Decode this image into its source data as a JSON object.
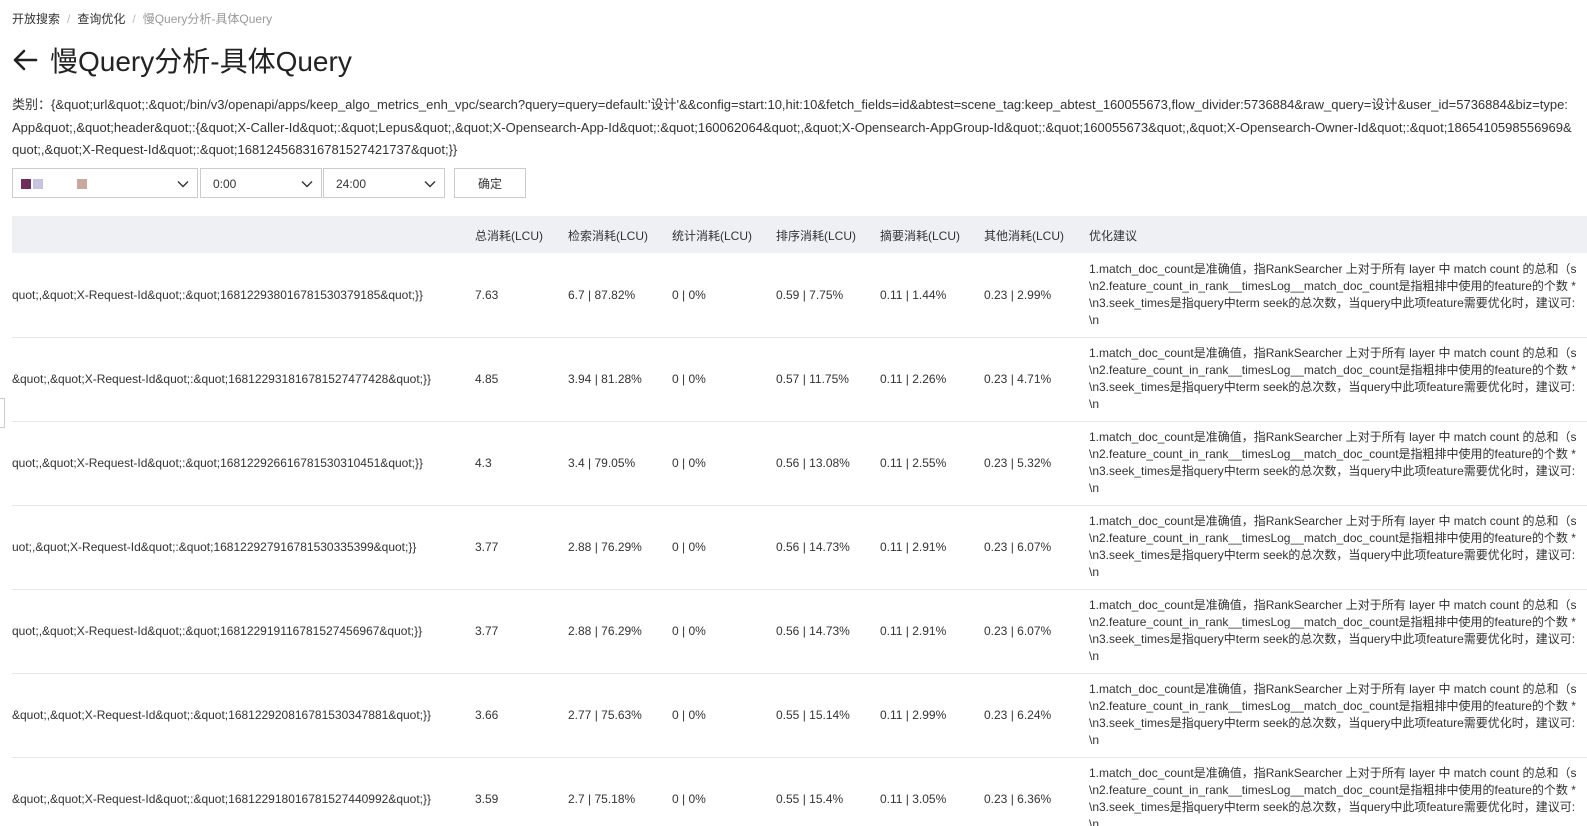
{
  "breadcrumb": [
    "开放搜索",
    "查询优化",
    "慢Query分析-具体Query"
  ],
  "title": "慢Query分析-具体Query",
  "category": {
    "label": "类别：",
    "text": "{&quot;url&quot;:&quot;/bin/v3/openapi/apps/keep_algo_metrics_enh_vpc/search?query=query=default:'设计'&&config=start:10,hit:10&fetch_fields=id&abtest=scene_tag:keep_abtest_160055673,flow_divider:5736884&raw_query=设计&user_id=5736884&biz=type:App&quot;,&quot;header&quot;:{&quot;X-Caller-Id&quot;:&quot;Lepus&quot;,&quot;X-Opensearch-App-Id&quot;:&quot;160062064&quot;,&quot;X-Opensearch-AppGroup-Id&quot;:&quot;160055673&quot;,&quot;X-Opensearch-Owner-Id&quot;:&quot;1865410598556969&quot;,&quot;X-Request-Id&quot;:&quot;168124568316781527421737&quot;}}"
  },
  "filters": {
    "date_swatch_colors": [
      "#6b2f5a",
      "#c7c3e0",
      "#c9a99e"
    ],
    "start_time": "0:00",
    "end_time": "24:00",
    "confirm_label": "确定"
  },
  "table": {
    "headers": [
      "总消耗(LCU)",
      "检索消耗(LCU)",
      "统计消耗(LCU)",
      "排序消耗(LCU)",
      "摘要消耗(LCU)",
      "其他消耗(LCU)",
      "优化建议"
    ],
    "rows": [
      {
        "query": "quot;,&quot;X-Request-Id&quot;:&quot;168122938016781530379185&quot;}}",
        "total": "7.63",
        "search": "6.7 | 87.82%",
        "stat": "0 | 0%",
        "rank": "0.59 | 7.75%",
        "summary": "0.11 | 1.44%",
        "other": "0.23 | 2.99%"
      },
      {
        "query": "&quot;,&quot;X-Request-Id&quot;:&quot;168122931816781527477428&quot;}}",
        "total": "4.85",
        "search": "3.94 | 81.28%",
        "stat": "0 | 0%",
        "rank": "0.57 | 11.75%",
        "summary": "0.11 | 2.26%",
        "other": "0.23 | 4.71%"
      },
      {
        "query": "quot;,&quot;X-Request-Id&quot;:&quot;168122926616781530310451&quot;}}",
        "total": "4.3",
        "search": "3.4 | 79.05%",
        "stat": "0 | 0%",
        "rank": "0.56 | 13.08%",
        "summary": "0.11 | 2.55%",
        "other": "0.23 | 5.32%"
      },
      {
        "query": "uot;,&quot;X-Request-Id&quot;:&quot;168122927916781530335399&quot;}}",
        "total": "3.77",
        "search": "2.88 | 76.29%",
        "stat": "0 | 0%",
        "rank": "0.56 | 14.73%",
        "summary": "0.11 | 2.91%",
        "other": "0.23 | 6.07%"
      },
      {
        "query": "quot;,&quot;X-Request-Id&quot;:&quot;168122919116781527456967&quot;}}",
        "total": "3.77",
        "search": "2.88 | 76.29%",
        "stat": "0 | 0%",
        "rank": "0.56 | 14.73%",
        "summary": "0.11 | 2.91%",
        "other": "0.23 | 6.07%"
      },
      {
        "query": "&quot;,&quot;X-Request-Id&quot;:&quot;168122920816781530347881&quot;}}",
        "total": "3.66",
        "search": "2.77 | 75.63%",
        "stat": "0 | 0%",
        "rank": "0.55 | 15.14%",
        "summary": "0.11 | 2.99%",
        "other": "0.23 | 6.24%"
      },
      {
        "query": "&quot;,&quot;X-Request-Id&quot;:&quot;168122918016781527440992&quot;}}",
        "total": "3.59",
        "search": "2.7 | 75.18%",
        "stat": "0 | 0%",
        "rank": "0.55 | 15.4%",
        "summary": "0.11 | 3.05%",
        "other": "0.23 | 6.36%"
      }
    ],
    "suggestion_lines": [
      "1.match_doc_count是准确值，指RankSearcher 上对于所有 layer 中 match count 的总和（s",
      "\\n2.feature_count_in_rank__timesLog__match_doc_count是指粗排中使用的feature的个数 *",
      "\\n3.seek_times是指query中term seek的总次数，当query中此项feature需要优化时，建议可:",
      "\\n"
    ]
  }
}
